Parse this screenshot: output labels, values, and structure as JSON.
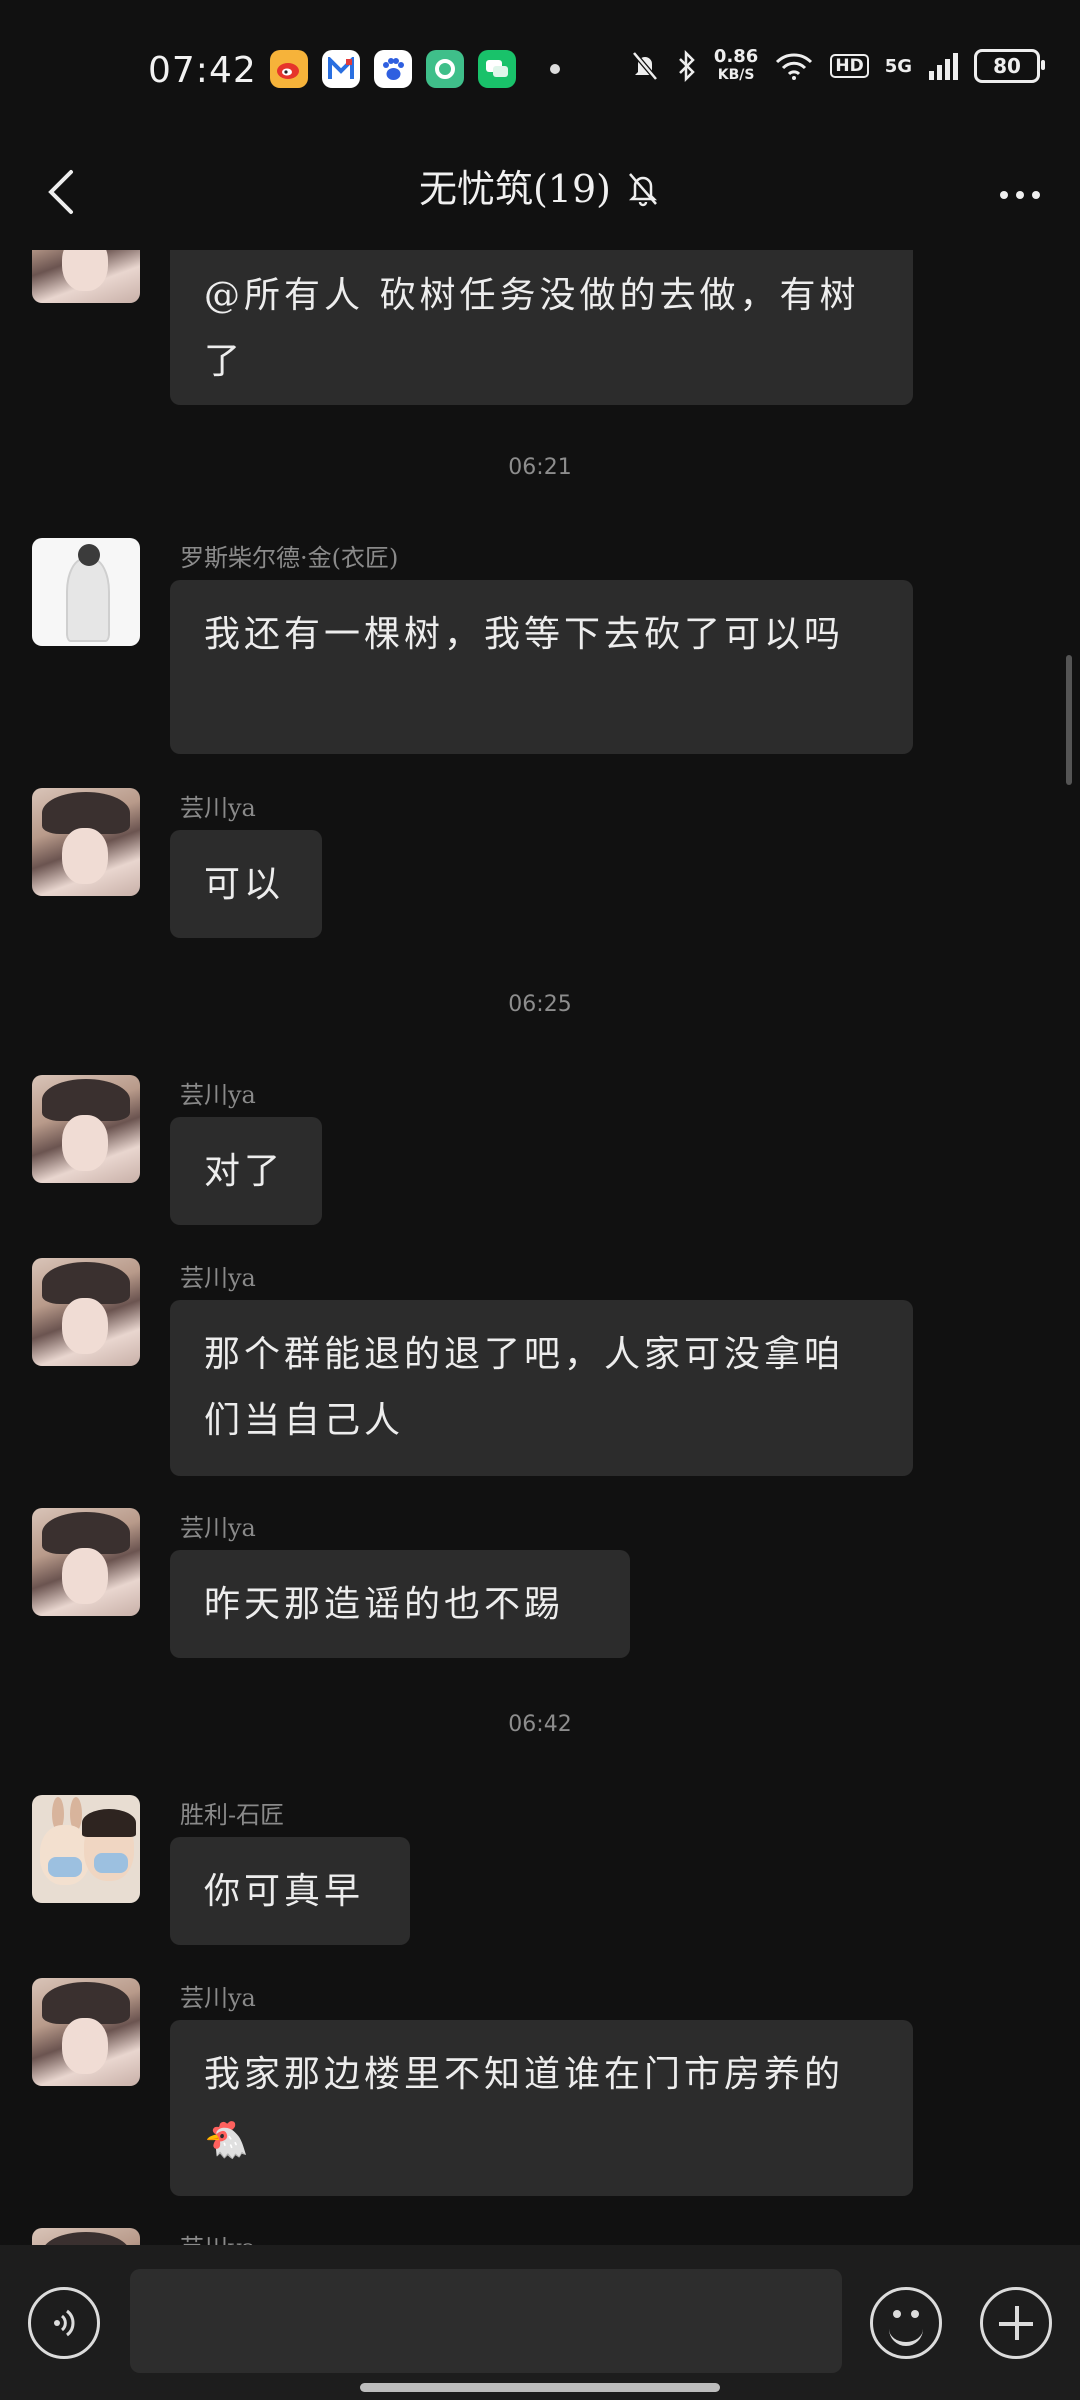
{
  "status_bar": {
    "time": "07:42",
    "speed_value": "0.86",
    "speed_unit": "KB/S",
    "hd": "HD",
    "network": "5G",
    "battery": "80",
    "app_icons": [
      "weibo-icon",
      "app-m-icon",
      "baidu-icon",
      "green-circle-app-icon",
      "chat-app-icon"
    ]
  },
  "header": {
    "title": "无忧筑(19)"
  },
  "messages": [
    {
      "sender": "",
      "text": "@所有人 砍树任务没做的去做，有树了",
      "avatar": "girl-hat-avatar"
    },
    {
      "timestamp": "06:21"
    },
    {
      "sender": "罗斯柴尔德·金(衣匠)",
      "text": "我还有一棵树，我等下去砍了可以吗",
      "avatar": "white-figure-avatar"
    },
    {
      "sender": "芸川ya",
      "text": "可以",
      "avatar": "girl-hat-avatar"
    },
    {
      "timestamp": "06:25"
    },
    {
      "sender": "芸川ya",
      "text": "对了",
      "avatar": "girl-hat-avatar"
    },
    {
      "sender": "芸川ya",
      "text": "那个群能退的退了吧，人家可没拿咱们当自己人",
      "avatar": "girl-hat-avatar"
    },
    {
      "sender": "芸川ya",
      "text": "昨天那造谣的也不踢",
      "avatar": "girl-hat-avatar"
    },
    {
      "timestamp": "06:42"
    },
    {
      "sender": "胜利-石匠",
      "text": "你可真早",
      "avatar": "couple-cartoon-avatar"
    },
    {
      "sender": "芸川ya",
      "text": "我家那边楼里不知道谁在门市房养的🐔",
      "avatar": "girl-hat-avatar"
    },
    {
      "sender": "芸川ya",
      "text": "",
      "avatar": "girl-hat-avatar"
    }
  ],
  "input": {
    "placeholder": ""
  }
}
